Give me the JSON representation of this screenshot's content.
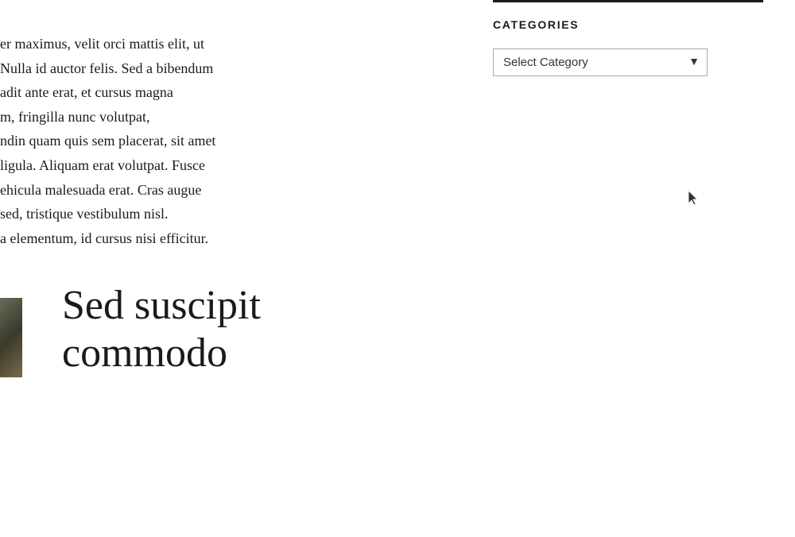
{
  "main": {
    "article_text_lines": [
      "er maximus, velit orci mattis elit, ut",
      "Nulla id auctor felis. Sed a bibendum",
      "adit ante erat, et cursus magna",
      "m, fringilla nunc volutpat,",
      "ndin quam quis sem placerat, sit amet",
      "ligula. Aliquam erat volutpat. Fusce",
      "ehicula malesuada erat. Cras augue",
      "sed, tristique vestibulum nisl.",
      "a elementum, id cursus nisi efficitur."
    ],
    "next_article_title": "Sed suscipit commodo"
  },
  "sidebar": {
    "top_line": true,
    "section_title": "CATEGORIES",
    "select_label": "Select Category",
    "select_options": [
      "Select Category"
    ]
  }
}
